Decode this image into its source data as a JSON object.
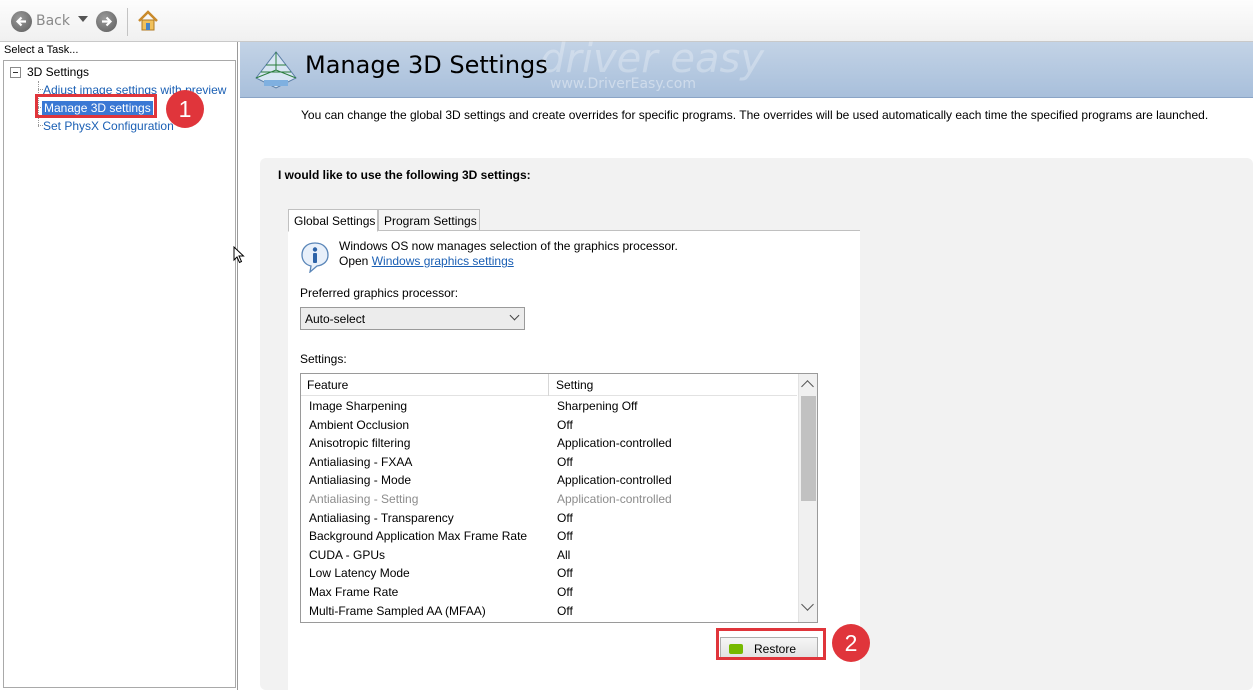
{
  "toolbar": {
    "back_label": "Back"
  },
  "task_pane": {
    "header": "Select a Task...",
    "root": "3D Settings",
    "items": [
      {
        "label": "Adjust image settings with preview"
      },
      {
        "label": "Manage 3D settings"
      },
      {
        "label": "Set PhysX Configuration"
      }
    ]
  },
  "callouts": {
    "step1": "1",
    "step2": "2"
  },
  "main": {
    "title": "Manage 3D Settings",
    "watermark": "driver easy",
    "watermark_url": "www.DriverEasy.com",
    "description": "You can change the global 3D settings and create overrides for specific programs. The overrides will be used automatically each time the specified programs are launched.",
    "group_title": "I would like to use the following 3D settings:",
    "tabs": [
      {
        "label": "Global Settings",
        "active": true
      },
      {
        "label": "Program Settings",
        "active": false
      }
    ],
    "info_line1": "Windows OS now manages selection of the graphics processor.",
    "info_open": "Open",
    "info_link": "Windows graphics settings",
    "preferred_label": "Preferred graphics processor:",
    "preferred_value": "Auto-select",
    "settings_label": "Settings:",
    "columns": {
      "feature": "Feature",
      "setting": "Setting"
    },
    "rows": [
      {
        "feature": "Image Sharpening",
        "setting": "Sharpening Off"
      },
      {
        "feature": "Ambient Occlusion",
        "setting": "Off"
      },
      {
        "feature": "Anisotropic filtering",
        "setting": "Application-controlled"
      },
      {
        "feature": "Antialiasing - FXAA",
        "setting": "Off"
      },
      {
        "feature": "Antialiasing - Mode",
        "setting": "Application-controlled"
      },
      {
        "feature": "Antialiasing - Setting",
        "setting": "Application-controlled",
        "disabled": true
      },
      {
        "feature": "Antialiasing - Transparency",
        "setting": "Off"
      },
      {
        "feature": "Background Application Max Frame Rate",
        "setting": "Off"
      },
      {
        "feature": "CUDA - GPUs",
        "setting": "All"
      },
      {
        "feature": "Low Latency Mode",
        "setting": "Off"
      },
      {
        "feature": "Max Frame Rate",
        "setting": "Off"
      },
      {
        "feature": "Multi-Frame Sampled AA (MFAA)",
        "setting": "Off"
      }
    ],
    "restore_label": "Restore"
  },
  "colors": {
    "accent_red": "#e0353b",
    "selection_blue": "#3a78d4",
    "banner": "#b4c8e0",
    "nvidia_green": "#76b900"
  }
}
